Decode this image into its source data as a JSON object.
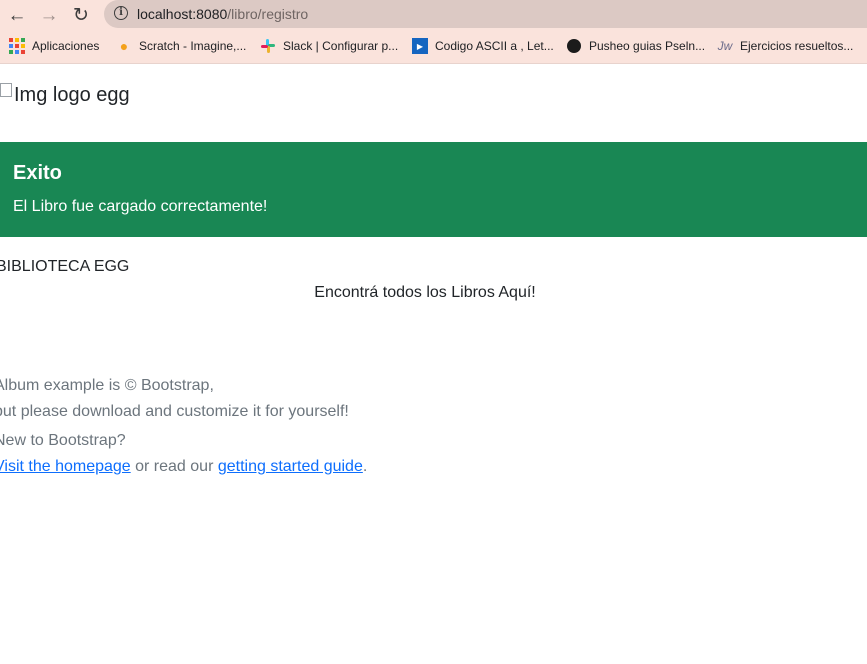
{
  "browser": {
    "url_host": "localhost:8080",
    "url_path": "/libro/registro",
    "bookmarks": [
      {
        "label": "Aplicaciones",
        "icon": "apps-grid-icon"
      },
      {
        "label": "Scratch - Imagine,...",
        "icon": "scratch-icon"
      },
      {
        "label": "Slack | Configurar p...",
        "icon": "slack-icon"
      },
      {
        "label": "Codigo ASCII a , Let...",
        "icon": "ascii-icon"
      },
      {
        "label": "Pusheo guias Pseln...",
        "icon": "github-icon"
      },
      {
        "label": "Ejercicios resueltos...",
        "icon": "ejercicios-icon"
      }
    ]
  },
  "page": {
    "logo_alt": "Img logo egg",
    "alert": {
      "title": "Exito",
      "message": "El Libro fue cargado correctamente!",
      "color": "#198754"
    },
    "brand": "BIBLIOTECA EGG",
    "lead": "Encontrá todos los Libros Aquí!",
    "footer": {
      "line1": "Album example is © Bootstrap,",
      "line2": "but please download and customize it for yourself!",
      "line3": "New to Bootstrap?",
      "link_homepage": "Visit the homepage",
      "middle_text": " or read our ",
      "link_guide": "getting started guide",
      "end_text": "."
    }
  }
}
